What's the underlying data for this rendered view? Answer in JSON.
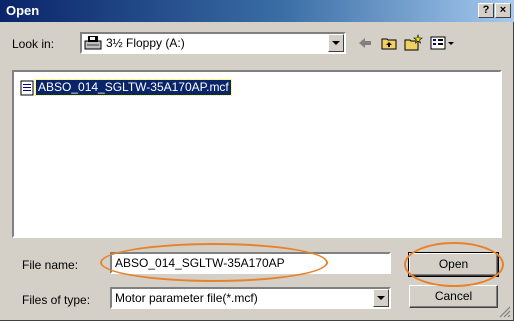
{
  "window": {
    "title": "Open",
    "help_label": "?",
    "close_label": "×"
  },
  "look_in": {
    "label": "Look in:",
    "value": "3½ Floppy (A:)",
    "icon": "floppy-drive-icon"
  },
  "toolbar": {
    "icons": [
      "back-arrow-icon",
      "up-folder-icon",
      "new-folder-icon",
      "view-menu-icon"
    ]
  },
  "file_list": {
    "items": [
      {
        "name": "ABSO_014_SGLTW-35A170AP.mcf",
        "selected": true,
        "icon": "file-icon"
      }
    ]
  },
  "file_name": {
    "label": "File name:",
    "value": "ABSO_014_SGLTW-35A170AP"
  },
  "file_type": {
    "label": "Files of type:",
    "value": "Motor parameter file(*.mcf)"
  },
  "buttons": {
    "open": "Open",
    "cancel": "Cancel"
  },
  "colors": {
    "title_start": "#0a246a",
    "title_end": "#a6caf0",
    "selection": "#0a246a",
    "highlight_ellipse": "#e8822a",
    "face": "#d4d0c8"
  }
}
